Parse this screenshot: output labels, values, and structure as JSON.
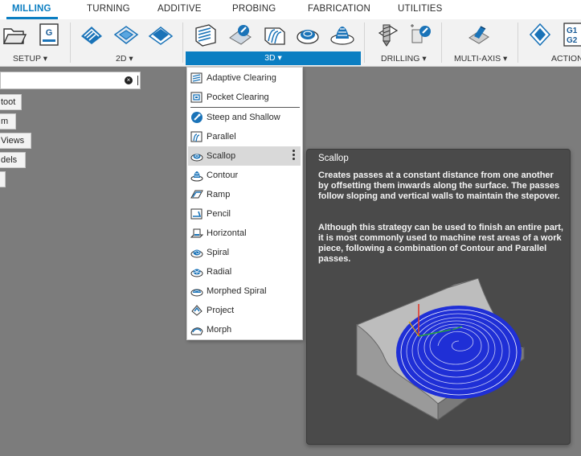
{
  "tabs": [
    {
      "id": "milling",
      "label": "MILLING",
      "active": true
    },
    {
      "id": "turning",
      "label": "TURNING"
    },
    {
      "id": "additive",
      "label": "ADDITIVE"
    },
    {
      "id": "probing",
      "label": "PROBING"
    },
    {
      "id": "fabrication",
      "label": "FABRICATION"
    },
    {
      "id": "utilities",
      "label": "UTILITIES"
    }
  ],
  "ribbon": {
    "setup": {
      "label": "SETUP ▾"
    },
    "two_d": {
      "label": "2D ▾"
    },
    "three_d": {
      "label": "3D ▾"
    },
    "drilling": {
      "label": "DRILLING ▾"
    },
    "multi_axis": {
      "label": "MULTI-AXIS ▾"
    },
    "action": {
      "label": "ACTION"
    },
    "setup_tool_letter": "G",
    "action_code_line1": "G1",
    "action_code_line2": "G2"
  },
  "browser": {
    "search_clear": "×",
    "items": [
      "toot",
      "m",
      "Views",
      "dels",
      ""
    ]
  },
  "menu": {
    "items": [
      {
        "label": "Adaptive Clearing",
        "icon": "adaptive-clearing-icon"
      },
      {
        "label": "Pocket Clearing",
        "icon": "pocket-clearing-icon"
      },
      {
        "label": "Steep and Shallow",
        "icon": "steep-and-shallow-icon"
      },
      {
        "label": "Parallel",
        "icon": "parallel-icon"
      },
      {
        "label": "Scallop",
        "icon": "scallop-icon",
        "highlighted": true
      },
      {
        "label": "Contour",
        "icon": "contour-icon"
      },
      {
        "label": "Ramp",
        "icon": "ramp-icon"
      },
      {
        "label": "Pencil",
        "icon": "pencil-icon"
      },
      {
        "label": "Horizontal",
        "icon": "horizontal-icon"
      },
      {
        "label": "Spiral",
        "icon": "spiral-icon"
      },
      {
        "label": "Radial",
        "icon": "radial-icon"
      },
      {
        "label": "Morphed Spiral",
        "icon": "morphed-spiral-icon"
      },
      {
        "label": "Project",
        "icon": "project-icon"
      },
      {
        "label": "Morph",
        "icon": "morph-icon"
      }
    ]
  },
  "tooltip": {
    "title": "Scallop",
    "paragraph1": "Creates passes at a constant distance from one another by offsetting them inwards along the surface. The passes follow sloping and vertical walls to maintain the stepover.",
    "paragraph2": "Although this strategy can be used to finish an entire part, it is most commonly used to machine rest areas of a work piece, following a combination of Contour and Parallel passes."
  },
  "colors": {
    "accent": "#0b7ec2",
    "tool_blue": "#1a73b8",
    "toolpath_blue": "#1f2fd6",
    "background": "#7c7c7c",
    "tooltip_bg": "#4a4a4a"
  }
}
